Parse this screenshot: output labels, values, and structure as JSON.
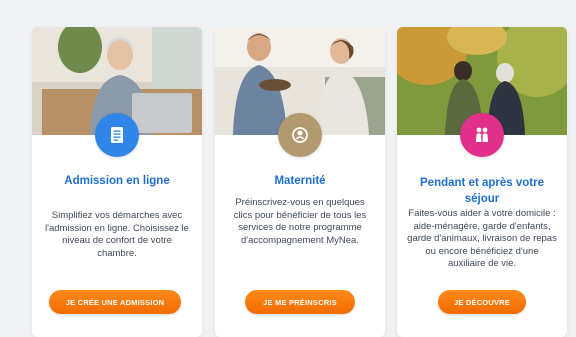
{
  "cards": [
    {
      "title": "Admission en ligne",
      "description": "Simplifiez vos démarches avec l'admission en ligne. Choisissez le niveau de confort de votre chambre.",
      "button_label": "JE CRÉE UNE ADMISSION",
      "icon": "document-icon",
      "icon_color": "#2f86e8"
    },
    {
      "title": "Maternité",
      "description": "Préinscrivez-vous en quelques clics pour bénéficier de tous les services de notre programme d'accompagnement MyNea.",
      "button_label": "JE ME PRÉINSCRIS",
      "icon": "baby-icon",
      "icon_color": "#b39a6e"
    },
    {
      "title": "Pendant et après votre séjour",
      "description": "Faites-vous aider à votre domicile : aide-ménagère, garde d'enfants, garde d'animaux, livraison de repas ou encore bénéficiez d'une auxiliaire de vie.",
      "button_label": "JE DÉCOUVRE",
      "icon": "elderly-couple-icon",
      "icon_color": "#e0308a"
    }
  ],
  "colors": {
    "accent_orange": "#f26b00",
    "title_blue": "#1f6fd1",
    "background": "#f1f2f4"
  }
}
